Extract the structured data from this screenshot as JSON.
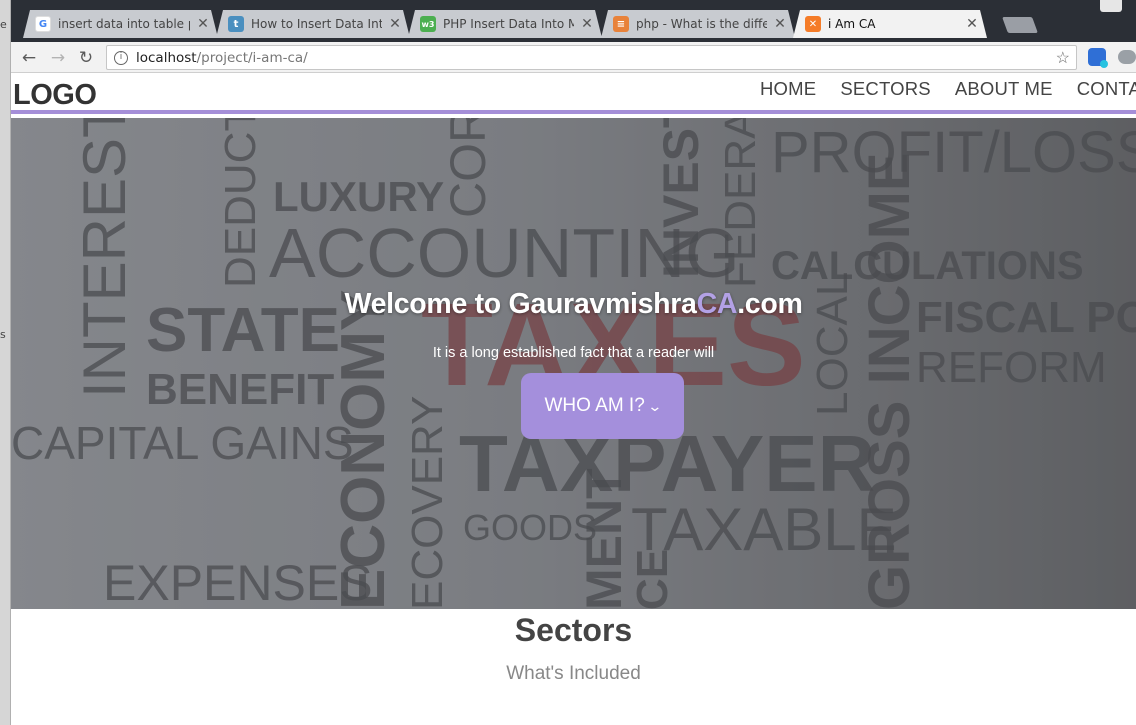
{
  "browser": {
    "tabs": [
      {
        "title": "insert data into table php",
        "favicon": "google-icon",
        "favicon_color": "#ffffff"
      },
      {
        "title": "How to Insert Data Into M",
        "favicon": "t-icon",
        "favicon_color": "#4a8fbf"
      },
      {
        "title": "PHP Insert Data Into MyS",
        "favicon": "w3-icon",
        "favicon_color": "#4caf50"
      },
      {
        "title": "php - What is the differe",
        "favicon": "stackoverflow-icon",
        "favicon_color": "#e8823a"
      },
      {
        "title": "i Am CA",
        "favicon": "xampp-icon",
        "favicon_color": "#f57c28"
      }
    ],
    "close_glyph": "✕",
    "url_host": "localhost",
    "url_path": "/project/i-am-ca/",
    "back_glyph": "←",
    "forward_glyph": "→",
    "reload_glyph": "↻",
    "info_glyph": "i",
    "star_glyph": "☆"
  },
  "site": {
    "logo": "LOGO",
    "menu": [
      "HOME",
      "SECTORS",
      "ABOUT ME",
      "CONTACT"
    ],
    "accent_color": "#a48fdc",
    "hero": {
      "title_pre": "Welcome to Gauravmishra",
      "title_accent": "CA",
      "title_post": ".com",
      "subtitle": "It is a long established fact that a reader will",
      "button_label": "WHO AM I?",
      "button_icon": "chevron-down-icon",
      "background_words": [
        "PROFIT/LOSS",
        "LUXURY",
        "ACCOUNTING",
        "CALCULATIONS",
        "FISCAL POLI",
        "REFORM",
        "STATE",
        "BENEFIT",
        "TAXES",
        "CAPITAL GAINS",
        "TAXPAYER",
        "GOODS",
        "TAXABLE",
        "EXPENSES",
        "INTEREST",
        "DEDUCTI",
        "CORP",
        "INVESTM",
        "FEDERAL",
        "ECONOMY",
        "ECOVERY",
        "LOCAL",
        "GROSS INCOME",
        "MENT",
        "CE"
      ]
    },
    "sectors": {
      "title": "Sectors",
      "subtitle": "What's Included"
    }
  },
  "left_strip": [
    "e",
    "s"
  ]
}
